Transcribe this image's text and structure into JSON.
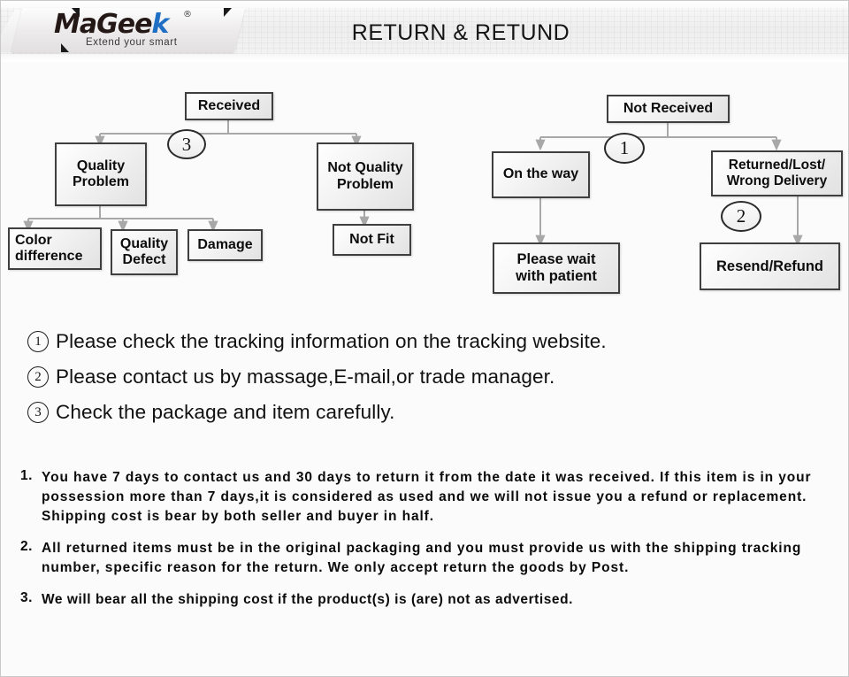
{
  "header": {
    "logo_word_main": "MaGee",
    "logo_word_accent": "k",
    "logo_registered": "®",
    "logo_tagline": "Extend your smart",
    "title": "RETURN & RETUND",
    "accent_color": "#1f6fc4"
  },
  "flowchart": {
    "left_branch": {
      "root": "Received",
      "marker": "3",
      "children": [
        {
          "label": "Quality\nProblem",
          "children": [
            "Color\ndifference",
            "Quality\nDefect",
            "Damage"
          ]
        },
        {
          "label": "Not Quality\nProblem",
          "children": [
            "Not Fit"
          ]
        }
      ]
    },
    "right_branch": {
      "root": "Not  Received",
      "marker": "1",
      "children": [
        {
          "label": "On the way",
          "children": [
            "Please wait\nwith patient"
          ]
        },
        {
          "label": "Returned/Lost/\nWrong Delivery",
          "marker": "2",
          "children": [
            "Resend/Refund"
          ]
        }
      ]
    },
    "nodes": {
      "received": "Received",
      "not_received": "Not  Received",
      "quality_problem": "Quality\nProblem",
      "not_quality_problem": "Not Quality\nProblem",
      "color_difference": "Color\ndifference",
      "quality_defect": "Quality\nDefect",
      "damage": "Damage",
      "not_fit": "Not Fit",
      "on_the_way": "On the way",
      "returned_lost_wrong": "Returned/Lost/\nWrong Delivery",
      "please_wait": "Please wait\nwith patient",
      "resend_refund": "Resend/Refund"
    },
    "markers": {
      "left": "3",
      "right": "1",
      "resend": "2"
    }
  },
  "legend": [
    {
      "number": "1",
      "text": "Please check the tracking information on the tracking website."
    },
    {
      "number": "2",
      "text": "Please contact us by  massage,E-mail,or trade manager."
    },
    {
      "number": "3",
      "text": "Check the package and item carefully."
    }
  ],
  "terms": [
    {
      "number": "1.",
      "text": "You have 7 days to contact us and 30 days to return it from the date it was received. If this item is in your possession more than 7 days,it is considered as used and we will not issue you a refund or replacement. Shipping cost is bear by both seller and buyer in half."
    },
    {
      "number": "2.",
      "text": "All returned items must be in the original packaging and you must provide us with the shipping tracking number, specific reason for the return. We only accept return the goods by Post."
    },
    {
      "number": "3.",
      "text": "We will bear all the shipping cost if the product(s) is (are) not as advertised."
    }
  ]
}
